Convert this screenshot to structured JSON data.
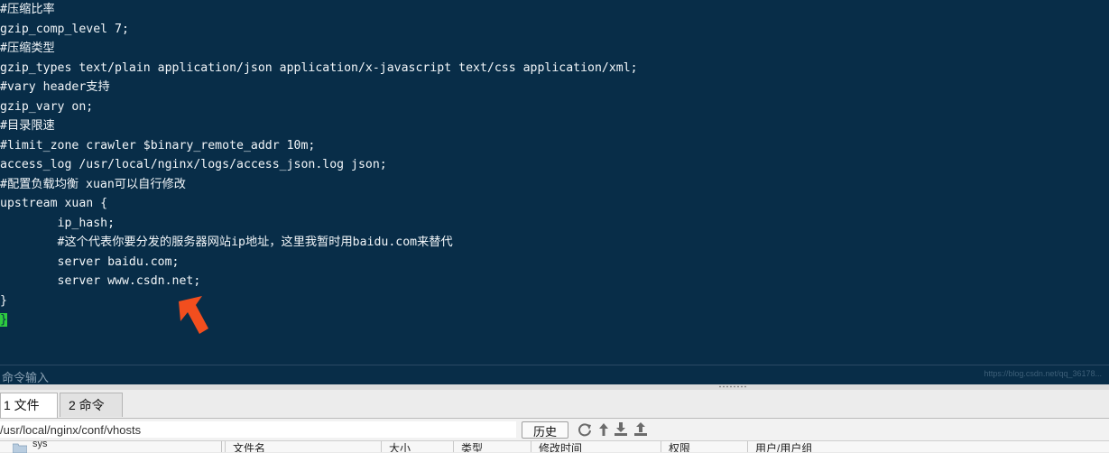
{
  "editor": {
    "lines": [
      "#压缩比率",
      "gzip_comp_level 7;",
      "#压缩类型",
      "gzip_types text/plain application/json application/x-javascript text/css application/xml;",
      "#vary header支持",
      "gzip_vary on;",
      "#目录限速",
      "#limit_zone crawler $binary_remote_addr 10m;",
      "access_log /usr/local/nginx/logs/access_json.log json;",
      "#配置负载均衡 xuan可以自行修改",
      "upstream xuan {",
      "        ip_hash;",
      "        #这个代表你要分发的服务器网站ip地址，这里我暂时用baidu.com来替代",
      "        server baidu.com;",
      "        server www.csdn.net;",
      "}",
      "}"
    ],
    "cursor_line_index": 16,
    "arrow_color": "#f24e1e"
  },
  "command_bar": {
    "label": "命令输入",
    "watermark": "https://blog.csdn.net/qq_36178..."
  },
  "tabs": [
    {
      "label": "1 文件",
      "active": true
    },
    {
      "label": "2 命令",
      "active": false
    }
  ],
  "path_bar": {
    "path": "/usr/local/nginx/conf/vhosts",
    "history_label": "历史"
  },
  "icons": {
    "refresh": "refresh-icon",
    "up": "up-arrow-icon",
    "download": "download-icon",
    "upload": "upload-icon",
    "folder": "folder-icon"
  },
  "file_list": {
    "tree_item": "sys",
    "columns": [
      "文件名",
      "大小",
      "类型",
      "修改时间",
      "权限",
      "用户/用户组"
    ]
  },
  "colors": {
    "terminal_bg": "#082d48",
    "terminal_fg": "#f2f6f9",
    "cursor": "#2ecc40",
    "icon": "#6b6b6b"
  }
}
